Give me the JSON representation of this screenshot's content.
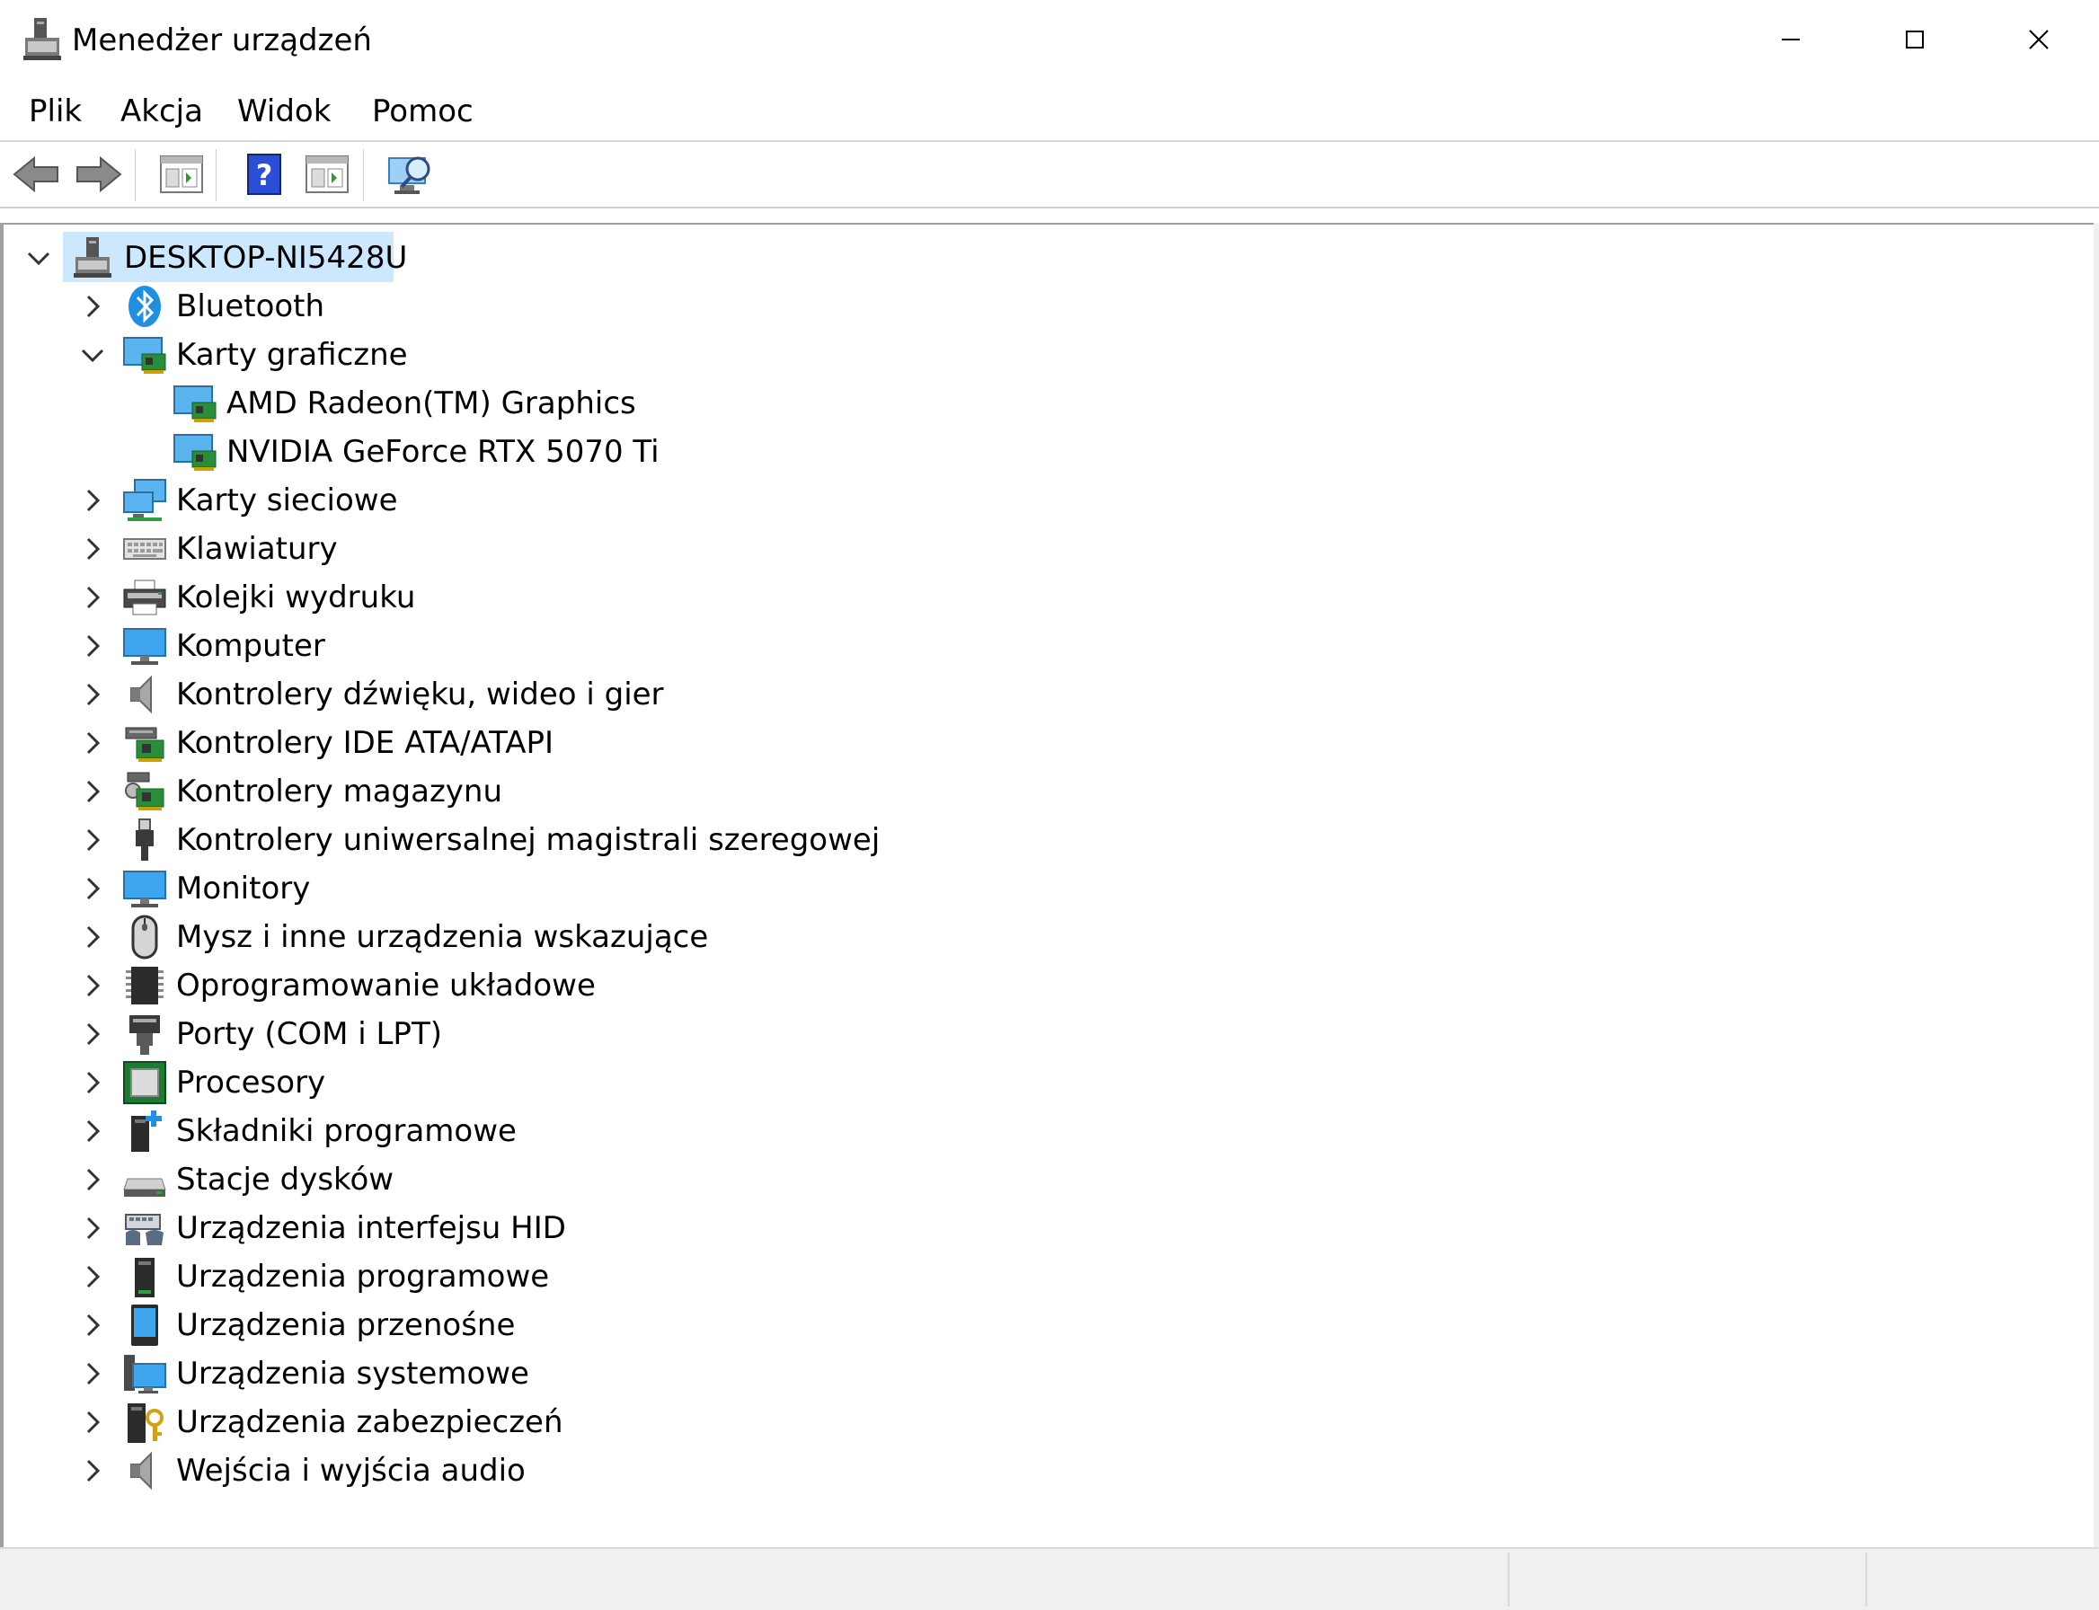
{
  "window": {
    "title": "Menedżer urządzeń",
    "controls": {
      "minimize_icon": "minimize-icon",
      "maximize_icon": "maximize-icon",
      "close_icon": "close-icon"
    }
  },
  "menu": {
    "items": [
      "Plik",
      "Akcja",
      "Widok",
      "Pomoc"
    ]
  },
  "toolbar": {
    "buttons": [
      "back-arrow-icon",
      "forward-arrow-icon",
      "properties-icon",
      "help-icon",
      "update-driver-icon",
      "scan-hardware-icon"
    ]
  },
  "tree": {
    "root": {
      "label": "DESKTOP-NI5428U",
      "expanded": true,
      "selected": true
    },
    "categories": [
      {
        "label": "Bluetooth",
        "icon": "bluetooth-icon",
        "expanded": false
      },
      {
        "label": "Karty graficzne",
        "icon": "display-adapter-icon",
        "expanded": true,
        "children": [
          "AMD Radeon(TM) Graphics",
          "NVIDIA GeForce RTX 5070 Ti"
        ]
      },
      {
        "label": "Karty sieciowe",
        "icon": "network-adapter-icon",
        "expanded": false
      },
      {
        "label": "Klawiatury",
        "icon": "keyboard-icon",
        "expanded": false
      },
      {
        "label": "Kolejki wydruku",
        "icon": "printer-icon",
        "expanded": false
      },
      {
        "label": "Komputer",
        "icon": "computer-icon",
        "expanded": false
      },
      {
        "label": "Kontrolery dźwięku, wideo i gier",
        "icon": "speaker-icon",
        "expanded": false
      },
      {
        "label": "Kontrolery IDE ATA/ATAPI",
        "icon": "ide-controller-icon",
        "expanded": false
      },
      {
        "label": "Kontrolery magazynu",
        "icon": "storage-controller-icon",
        "expanded": false
      },
      {
        "label": "Kontrolery uniwersalnej magistrali szeregowej",
        "icon": "usb-icon",
        "expanded": false
      },
      {
        "label": "Monitory",
        "icon": "monitor-icon",
        "expanded": false
      },
      {
        "label": "Mysz i inne urządzenia wskazujące",
        "icon": "mouse-icon",
        "expanded": false
      },
      {
        "label": "Oprogramowanie układowe",
        "icon": "firmware-chip-icon",
        "expanded": false
      },
      {
        "label": "Porty (COM i LPT)",
        "icon": "port-icon",
        "expanded": false
      },
      {
        "label": "Procesory",
        "icon": "processor-icon",
        "expanded": false
      },
      {
        "label": "Składniki programowe",
        "icon": "software-component-icon",
        "expanded": false
      },
      {
        "label": "Stacje dysków",
        "icon": "disk-drive-icon",
        "expanded": false
      },
      {
        "label": "Urządzenia interfejsu HID",
        "icon": "hid-icon",
        "expanded": false
      },
      {
        "label": "Urządzenia programowe",
        "icon": "software-device-icon",
        "expanded": false
      },
      {
        "label": "Urządzenia przenośne",
        "icon": "portable-device-icon",
        "expanded": false
      },
      {
        "label": "Urządzenia systemowe",
        "icon": "system-device-icon",
        "expanded": false
      },
      {
        "label": "Urządzenia zabezpieczeń",
        "icon": "security-device-icon",
        "expanded": false
      },
      {
        "label": "Wejścia i wyjścia audio",
        "icon": "audio-io-icon",
        "expanded": false
      }
    ]
  },
  "colors": {
    "selection": "#cce8ff",
    "border": "#a0a0a0",
    "statusbar": "#f0f0f0",
    "accent_blue": "#1e8fe1"
  }
}
